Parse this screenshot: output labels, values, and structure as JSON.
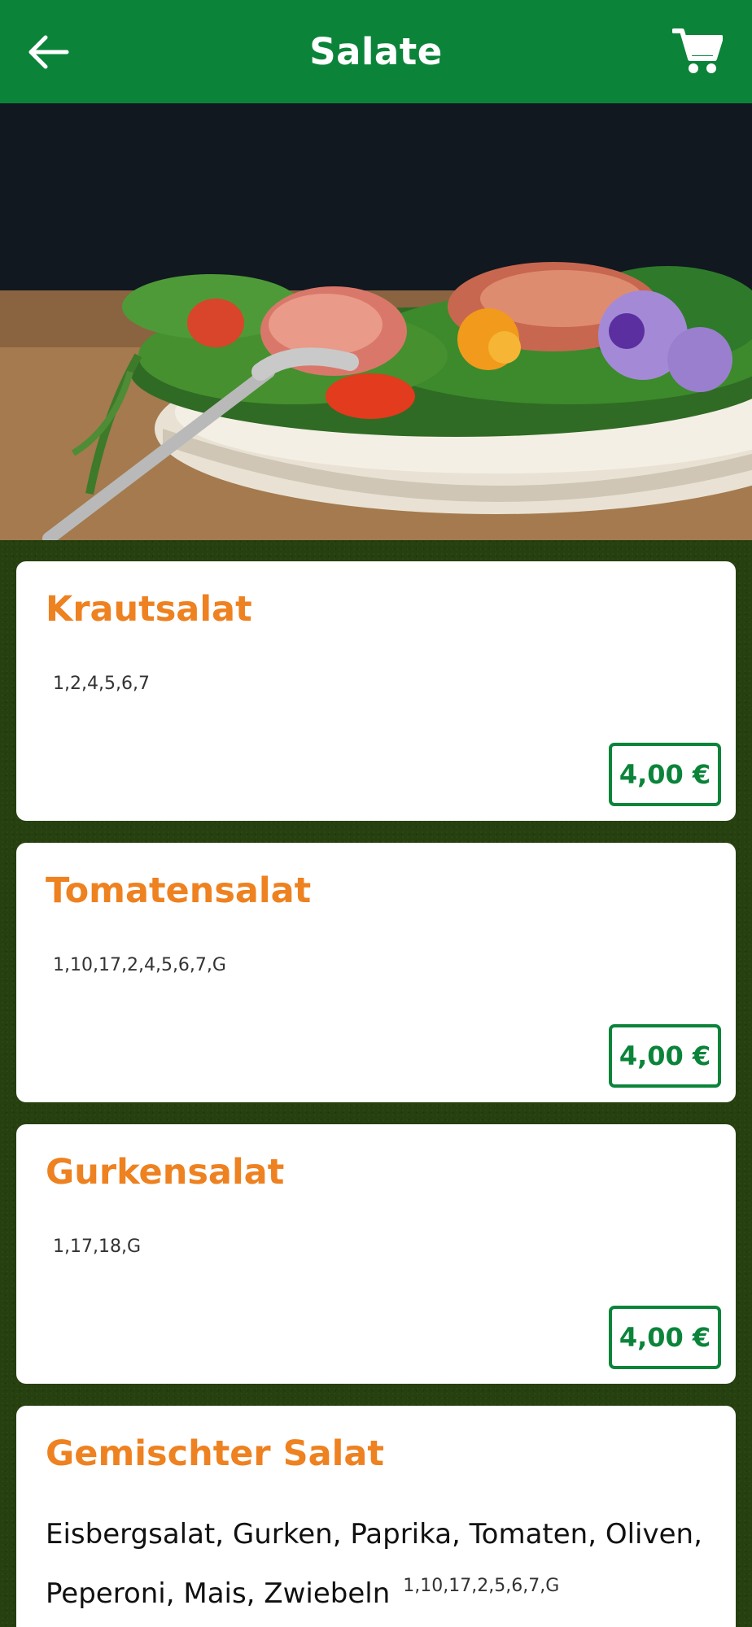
{
  "header": {
    "title": "Salate",
    "back_icon": "arrow-left-icon",
    "cart_icon": "shopping-cart-icon",
    "background_color": "#0b843a"
  },
  "hero": {
    "subject": "salad-plate-image"
  },
  "theme": {
    "accent_orange": "#ee8120",
    "accent_green": "#0b843a"
  },
  "products": [
    {
      "name": "Krautsalat",
      "allergens": "1,2,4,5,6,7",
      "price": "4,00 €"
    },
    {
      "name": "Tomatensalat",
      "allergens": "1,10,17,2,4,5,6,7,G",
      "price": "4,00 €"
    },
    {
      "name": "Gurkensalat",
      "allergens": "1,17,18,G",
      "price": "4,00 €"
    },
    {
      "name": "Gemischter Salat",
      "description": "Eisbergsalat, Gurken, Paprika, Tomaten, Oliven, Peperoni, Mais, Zwiebeln",
      "allergens": "1,10,17,2,5,6,7,G"
    }
  ]
}
